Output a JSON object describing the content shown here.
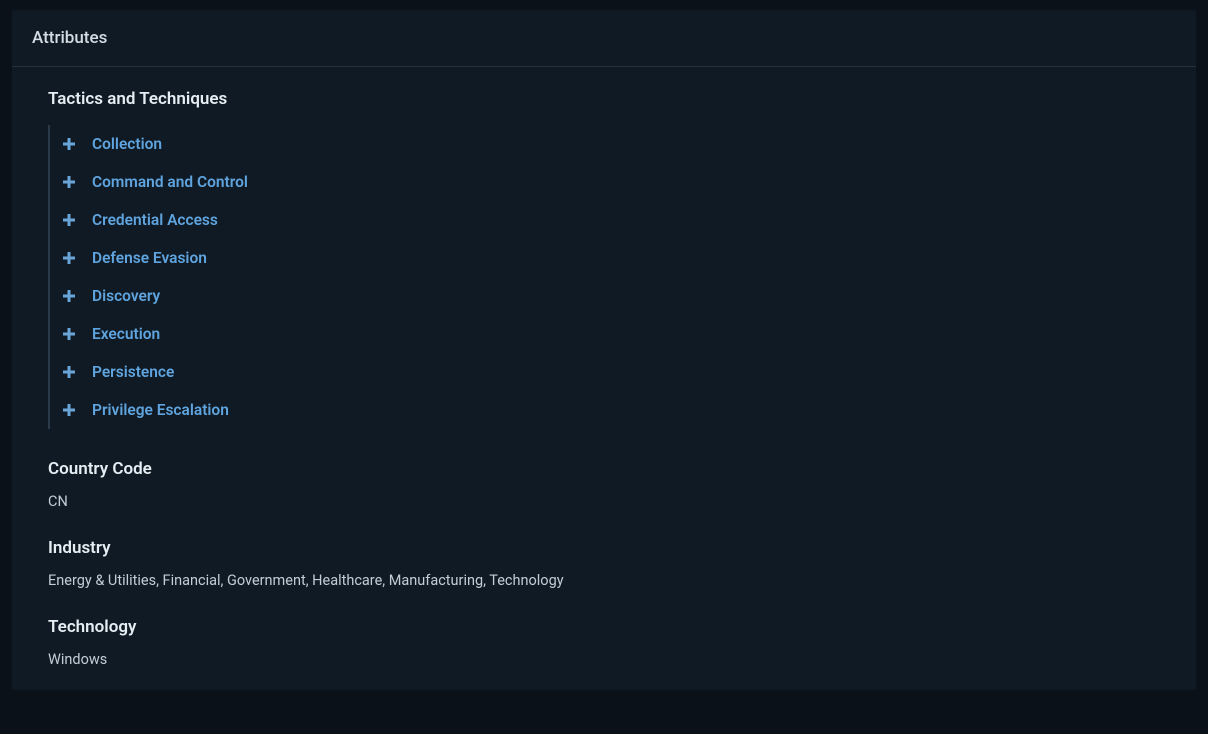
{
  "panel": {
    "title": "Attributes"
  },
  "tactics": {
    "heading": "Tactics and Techniques",
    "items": [
      {
        "label": "Collection"
      },
      {
        "label": "Command and Control"
      },
      {
        "label": "Credential Access"
      },
      {
        "label": "Defense Evasion"
      },
      {
        "label": "Discovery"
      },
      {
        "label": "Execution"
      },
      {
        "label": "Persistence"
      },
      {
        "label": "Privilege Escalation"
      }
    ]
  },
  "country_code": {
    "heading": "Country Code",
    "value": "CN"
  },
  "industry": {
    "heading": "Industry",
    "value": "Energy & Utilities, Financial, Government, Healthcare, Manufacturing, Technology"
  },
  "technology": {
    "heading": "Technology",
    "value": "Windows"
  }
}
